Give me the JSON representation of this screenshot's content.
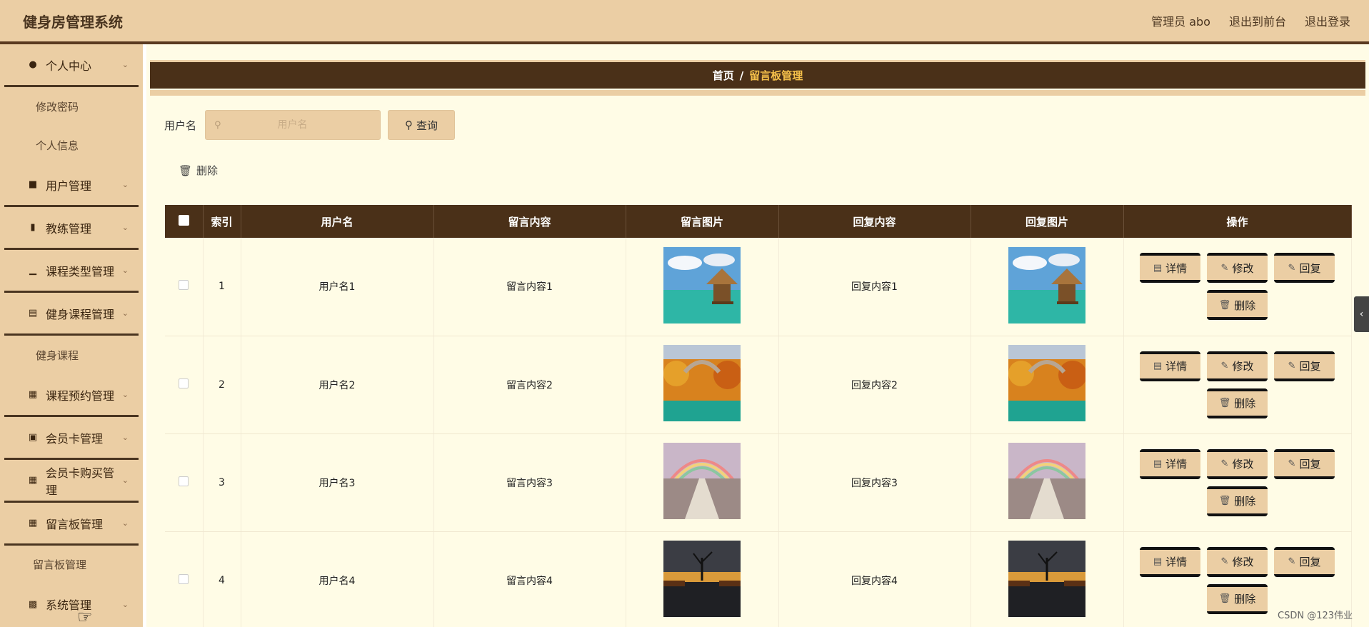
{
  "header": {
    "title": "健身房管理系统",
    "admin": "管理员 abo",
    "to_front": "退出到前台",
    "logout": "退出登录"
  },
  "sidebar": {
    "groups": [
      {
        "icon": "user-icon",
        "label": "个人中心",
        "children": [
          "修改密码",
          "个人信息"
        ]
      },
      {
        "icon": "monitor-icon",
        "label": "用户管理",
        "children": []
      },
      {
        "icon": "bookmark-icon",
        "label": "教练管理",
        "children": []
      },
      {
        "icon": "bar-chart-icon",
        "label": "课程类型管理",
        "children": []
      },
      {
        "icon": "document-icon",
        "label": "健身课程管理",
        "children": [
          "健身课程"
        ]
      },
      {
        "icon": "grid-icon",
        "label": "课程预约管理",
        "children": []
      },
      {
        "icon": "briefcase-icon",
        "label": "会员卡管理",
        "children": []
      },
      {
        "icon": "grid-icon",
        "label": "会员卡购买管理",
        "children": []
      },
      {
        "icon": "grid-icon",
        "label": "留言板管理",
        "children": [
          "留言板管理"
        ]
      },
      {
        "icon": "chat-icon",
        "label": "系统管理",
        "children": []
      }
    ]
  },
  "breadcrumb": {
    "home": "首页",
    "separator": "/",
    "current": "留言板管理"
  },
  "search": {
    "label": "用户名",
    "placeholder": "用户名",
    "value": "",
    "button": "查询"
  },
  "bulk_delete": "删除",
  "table": {
    "headers": [
      "索引",
      "用户名",
      "留言内容",
      "留言图片",
      "回复内容",
      "回复图片",
      "操作"
    ],
    "rows": [
      {
        "index": "1",
        "username": "用户名1",
        "content": "留言内容1",
        "image": "beach-hut",
        "reply": "回复内容1",
        "reply_image": "beach-hut"
      },
      {
        "index": "2",
        "username": "用户名2",
        "content": "留言内容2",
        "image": "autumn-bridge",
        "reply": "回复内容2",
        "reply_image": "autumn-bridge"
      },
      {
        "index": "3",
        "username": "用户名3",
        "content": "留言内容3",
        "image": "rainbow-path",
        "reply": "回复内容3",
        "reply_image": "rainbow-path"
      },
      {
        "index": "4",
        "username": "用户名4",
        "content": "留言内容4",
        "image": "tree-sunset",
        "reply": "回复内容4",
        "reply_image": "tree-sunset"
      }
    ],
    "actions": {
      "detail": "详情",
      "edit": "修改",
      "reply": "回复",
      "delete": "删除"
    }
  },
  "watermark": "CSDN @123伟业",
  "colors": {
    "accent": "#ebcea4",
    "dark": "#4a3018",
    "highlight": "#f5c04a",
    "background": "#fffce6"
  }
}
